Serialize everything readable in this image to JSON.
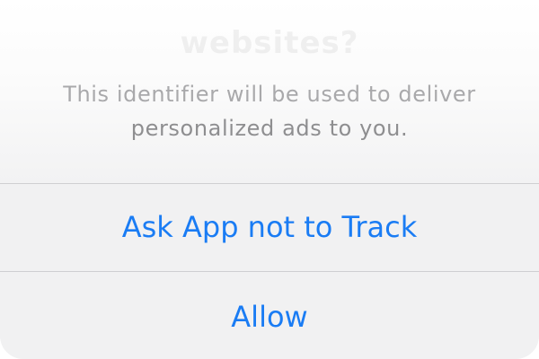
{
  "alert": {
    "title_partial": "websites?",
    "message_line_1": "This identifier will be used to deliver",
    "message_line_2": "personalized ads to you."
  },
  "actions": {
    "ask_not_to_track_label": "Ask App not to Track",
    "allow_label": "Allow"
  },
  "colors": {
    "action_blue": "#1a7cf4",
    "message_gray": "#8e8e90",
    "separator": "#cfcfd2",
    "sheet_background": "#f1f1f2"
  }
}
